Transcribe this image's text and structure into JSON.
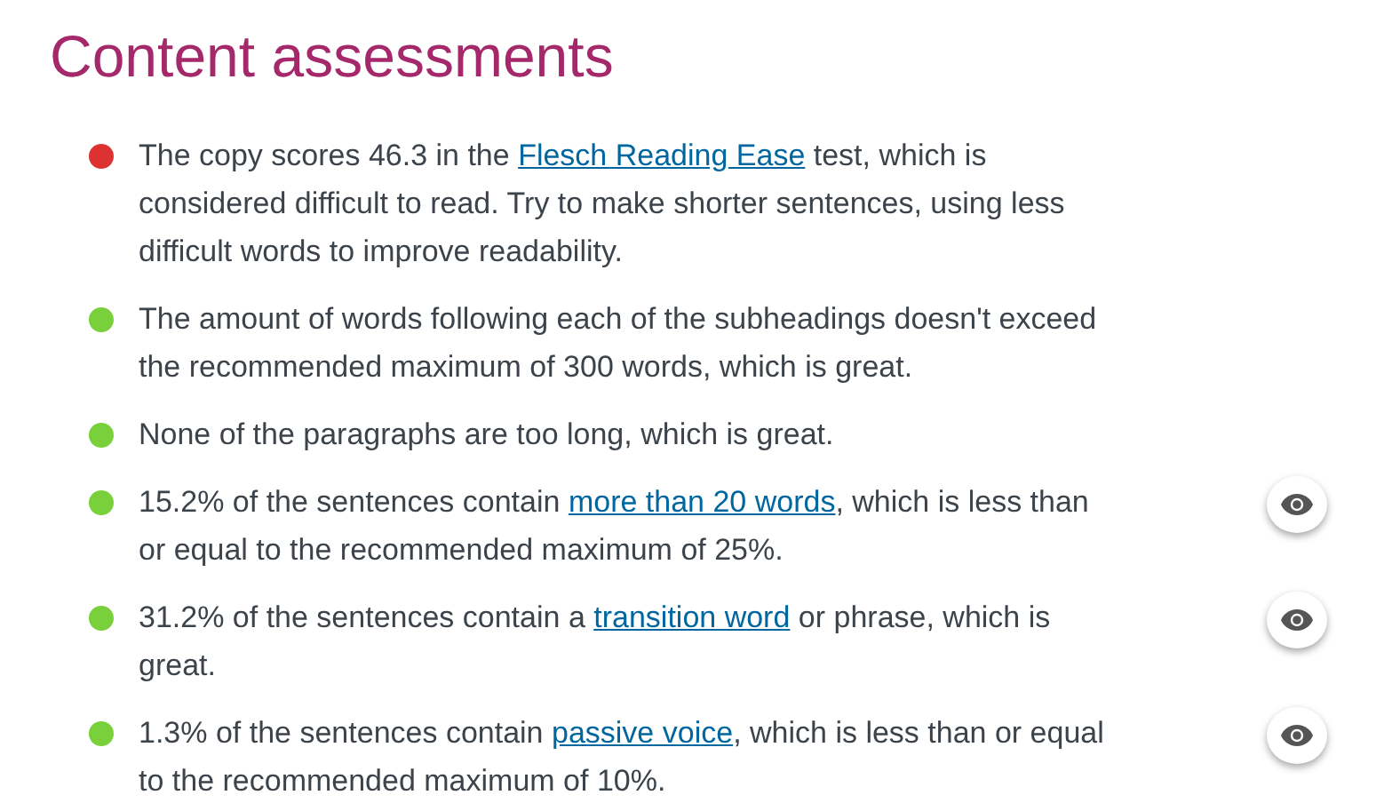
{
  "title": "Content assessments",
  "assessments": [
    {
      "color": "#dc3232",
      "eye_button": false,
      "parts": [
        {
          "text": "The copy scores 46.3 in the "
        },
        {
          "text": "Flesch Reading Ease",
          "link": true
        },
        {
          "text": " test, which is considered difficult to read. Try to make shorter sentences, using less difficult words to improve readability."
        }
      ]
    },
    {
      "color": "#7ad03a",
      "eye_button": false,
      "parts": [
        {
          "text": "The amount of words following each of the subheadings doesn't exceed the recommended maximum of 300 words, which is great."
        }
      ]
    },
    {
      "color": "#7ad03a",
      "eye_button": false,
      "parts": [
        {
          "text": "None of the paragraphs are too long, which is great."
        }
      ]
    },
    {
      "color": "#7ad03a",
      "eye_button": true,
      "parts": [
        {
          "text": "15.2% of the sentences contain "
        },
        {
          "text": "more than 20 words",
          "link": true
        },
        {
          "text": ", which is less than or equal to the recommended maximum of 25%."
        }
      ]
    },
    {
      "color": "#7ad03a",
      "eye_button": true,
      "parts": [
        {
          "text": "31.2% of the sentences contain a "
        },
        {
          "text": "transition word",
          "link": true
        },
        {
          "text": " or phrase, which is great."
        }
      ]
    },
    {
      "color": "#7ad03a",
      "eye_button": true,
      "parts": [
        {
          "text": "1.3% of the sentences contain "
        },
        {
          "text": "passive voice",
          "link": true
        },
        {
          "text": ", which is less than or equal to the recommended maximum of 10%."
        }
      ]
    }
  ]
}
